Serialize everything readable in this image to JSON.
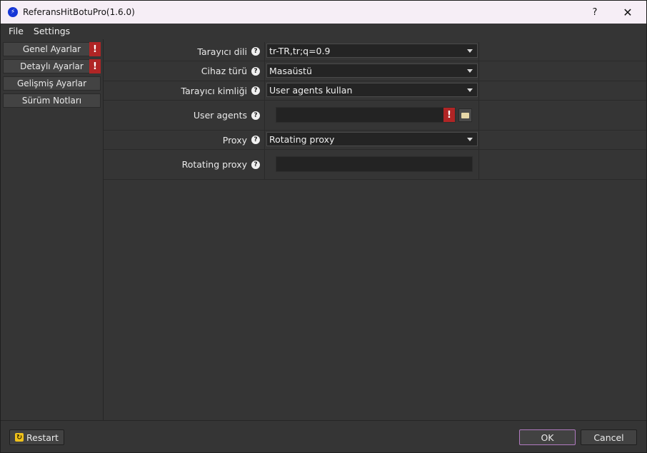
{
  "window": {
    "title": "ReferansHitBotuPro(1.6.0)",
    "help_glyph": "?",
    "close_glyph": "✕",
    "app_icon_glyph": "⚡"
  },
  "menu": {
    "items": [
      {
        "label": "File"
      },
      {
        "label": "Settings"
      }
    ]
  },
  "sidebar": {
    "items": [
      {
        "label": "Genel Ayarlar",
        "warning": true
      },
      {
        "label": "Detaylı Ayarlar",
        "warning": true
      },
      {
        "label": "Gelişmiş Ayarlar",
        "warning": false
      },
      {
        "label": "Sürüm Notları",
        "warning": false
      }
    ],
    "warning_glyph": "!"
  },
  "settings": {
    "browser_language": {
      "label": "Tarayıcı dili",
      "value": "tr-TR,tr;q=0.9"
    },
    "device_type": {
      "label": "Cihaz türü",
      "value": "Masaüstü"
    },
    "browser_identity": {
      "label": "Tarayıcı kimliği",
      "value": "User agents kullan"
    },
    "user_agents": {
      "label": "User agents",
      "value": "",
      "warning": true
    },
    "proxy": {
      "label": "Proxy",
      "value": "Rotating proxy"
    },
    "rotating_proxy": {
      "label": "Rotating proxy",
      "value": ""
    }
  },
  "help_glyph": "?",
  "buttons": {
    "restart": "Restart",
    "ok": "OK",
    "cancel": "Cancel"
  },
  "colors": {
    "accent_warning": "#b02525",
    "ok_border": "#b07ac0",
    "app_icon": "#1636d6"
  }
}
